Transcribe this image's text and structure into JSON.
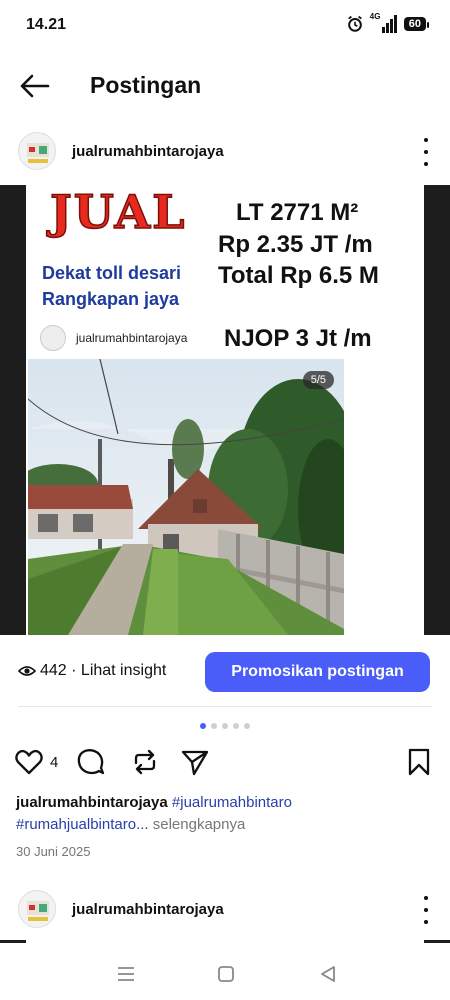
{
  "status_bar": {
    "time": "14.21",
    "network": "4G",
    "battery": "60"
  },
  "header": {
    "title": "Postingan"
  },
  "post": {
    "username": "jualrumahbintarojaya",
    "image": {
      "headline": "JUAL",
      "land_area": "LT 2771 M²",
      "price_per_meter": "Rp 2.35 JT /m",
      "total_price": "Total Rp 6.5 M",
      "location_line_1": "Dekat toll desari",
      "location_line_2": "Rangkapan jaya",
      "inner_username": "jualrumahbintarojaya",
      "njop": "NJOP 3 Jt /m",
      "photo_counter": "5/5"
    },
    "insight": {
      "views": "442 · Lihat insight"
    },
    "promote_button": "Promosikan postingan",
    "carousel": {
      "total": 5,
      "active": 1
    },
    "likes": "4",
    "caption": {
      "user": "jualrumahbintarojaya",
      "hashtag_1": "#jualrumahbintaro",
      "hashtag_2": "#rumahjualbintaro...",
      "more": "selengkapnya"
    },
    "date": "30 Juni 2025"
  },
  "next_post": {
    "username": "jualrumahbintarojaya"
  },
  "icons": {
    "back": "back-arrow-icon",
    "like": "heart-icon",
    "comment": "comment-icon",
    "repost": "repost-icon",
    "share": "send-icon",
    "save": "bookmark-icon",
    "views": "eye-icon"
  },
  "colors": {
    "accent": "#4a5df9",
    "jual_red": "#e62a1d",
    "location_blue": "#1e3b9e",
    "hashtag": "#2a3fa8"
  }
}
